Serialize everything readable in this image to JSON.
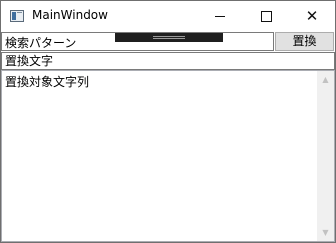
{
  "window": {
    "title": "MainWindow"
  },
  "titlebar_buttons": {
    "close_glyph": "✕"
  },
  "search": {
    "pattern_value": "検索パターン",
    "replace_button_label": "置換"
  },
  "replacement": {
    "value": "置換文字"
  },
  "target": {
    "text": "置換対象文字列"
  },
  "scrollbar": {
    "up_glyph": "▲",
    "down_glyph": "▼"
  }
}
